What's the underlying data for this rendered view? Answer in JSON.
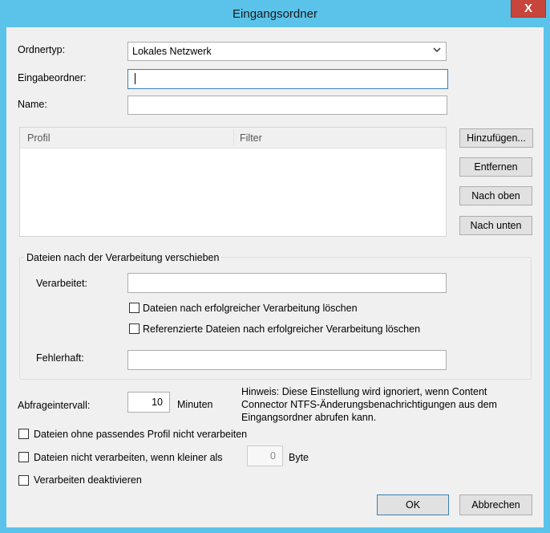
{
  "window": {
    "title": "Eingangsordner",
    "close_label": "X"
  },
  "form": {
    "folder_type_label": "Ordnertyp:",
    "folder_type_value": "Lokales Netzwerk",
    "input_folder_label": "Eingabeordner:",
    "input_folder_value": "",
    "name_label": "Name:",
    "name_value": ""
  },
  "profiles_table": {
    "columns": [
      "Profil",
      "Filter"
    ],
    "rows": []
  },
  "side_buttons": {
    "add": "Hinzufügen...",
    "remove": "Entfernen",
    "move_up": "Nach oben",
    "move_down": "Nach unten"
  },
  "move_group": {
    "title": "Dateien nach der Verarbeitung verschieben",
    "processed_label": "Verarbeitet:",
    "processed_value": "",
    "delete_processed_label": "Dateien nach erfolgreicher Verarbeitung löschen",
    "delete_processed_checked": false,
    "delete_referenced_label": "Referenzierte Dateien nach erfolgreicher Verarbeitung löschen",
    "delete_referenced_checked": false,
    "failed_label": "Fehlerhaft:",
    "failed_value": ""
  },
  "polling": {
    "label": "Abfrageintervall:",
    "value": "10",
    "unit": "Minuten",
    "note": "Hinweis: Diese Einstellung wird ignoriert, wenn Content Connector NTFS-Änderungsbenachrichtigungen aus dem Eingangsordner abrufen kann."
  },
  "options": {
    "skip_unmatched_label": "Dateien ohne passendes Profil nicht verarbeiten",
    "skip_unmatched_checked": false,
    "skip_smaller_label": "Dateien nicht verarbeiten, wenn kleiner als",
    "skip_smaller_checked": false,
    "min_size_value": "0",
    "min_size_unit": "Byte",
    "disable_processing_label": "Verarbeiten deaktivieren",
    "disable_processing_checked": false
  },
  "footer": {
    "ok": "OK",
    "cancel": "Abbrechen"
  },
  "colors": {
    "title_bar": "#5bc3ea",
    "close_button": "#c7453b",
    "dialog_bg": "#f0f0f0",
    "focus_border": "#3c7fb1"
  }
}
